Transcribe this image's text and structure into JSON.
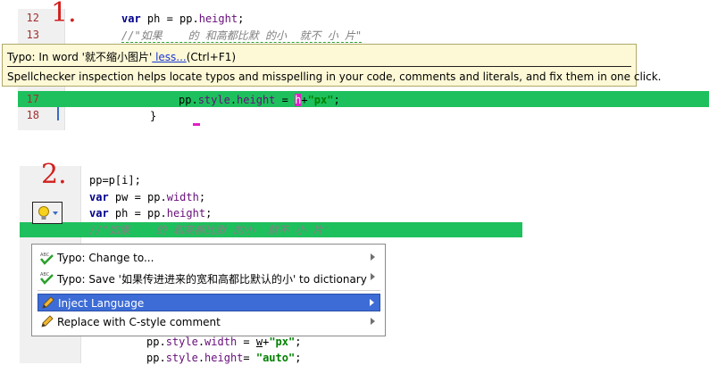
{
  "labels": {
    "step1": "1.",
    "step2": "2."
  },
  "panel1": {
    "line_numbers": [
      "12",
      "13",
      "17",
      "18"
    ],
    "line12": {
      "kw": "var",
      "name": " ph = ",
      "obj": "pp",
      "dot": ".",
      "prop": "height",
      "end": ";"
    },
    "line13": {
      "comment": "//\"如果    的 和高都比默 的小  就不 小 片\""
    },
    "line17": {
      "obj": "pp",
      "p1": "style",
      "p2": "height",
      "eq": " = ",
      "cursor": "h",
      "plus": "+",
      "str": "\"px\"",
      "end": ";"
    },
    "line18": {
      "brace": "}"
    }
  },
  "tooltip": {
    "prefix": "Typo: In word '就不缩小图片'",
    "link": " less...",
    "shortcut": "(Ctrl+F1)",
    "description": "Spellchecker inspection helps locate typos and misspelling in your code, comments and literals, and fix them in one click."
  },
  "panel2": {
    "lines": {
      "pp_assign": "pp=p[i];",
      "pw_kw": "var",
      "pw_rest": " pw = ",
      "pw_obj": "pp",
      "pw_prop": "width",
      "pw_end": ";",
      "ph_kw": "var",
      "ph_rest": " ph = ",
      "ph_obj": "pp",
      "ph_prop": "height",
      "ph_end": ";",
      "comment": "//\"如果    的 和高都比默 的小  就不 小 片\"",
      "w_obj": "pp",
      "w_p1": "style",
      "w_p2": "width",
      "w_eq": " = ",
      "w_var": "w",
      "w_plus": "+",
      "w_str": "\"px\"",
      "w_end": ";",
      "h_obj": "pp",
      "h_p1": "style",
      "h_p2": "height",
      "h_eq": "= ",
      "h_str": "\"auto\"",
      "h_end": ";"
    }
  },
  "popup_menu": {
    "items": [
      {
        "label": "Typo: Change to...",
        "icon": "spellcheck-icon"
      },
      {
        "label": "Typo: Save '如果传进进来的宽和高都比默认的小' to dictionary",
        "icon": "spellcheck-icon"
      },
      {
        "label": "Inject Language",
        "icon": "pencil-icon"
      },
      {
        "label": "Replace with C-style comment",
        "icon": "pencil-icon"
      }
    ]
  },
  "colors": {
    "highlight": "#1ec05d",
    "selection": "#3d6cd6",
    "step_label": "#d2201e",
    "cursor": "#e21ec8"
  }
}
